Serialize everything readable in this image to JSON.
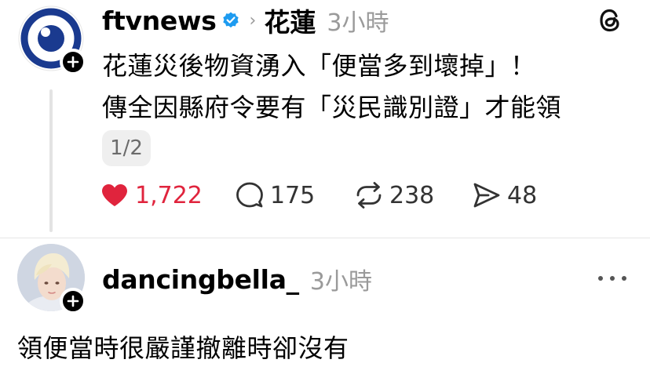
{
  "post": {
    "username": "ftvnews",
    "topic": "花蓮",
    "time": "3小時",
    "lines": [
      "花蓮災後物資湧入「便當多到壞掉」！",
      "傳全因縣府令要有「災民識別證」才能領"
    ],
    "media_page": "1/2",
    "likes": "1,722",
    "comments": "175",
    "reposts": "238",
    "shares": "48"
  },
  "reply": {
    "username": "dancingbella_",
    "time": "3小時",
    "text": "領便當時很嚴謹撤離時卻沒有"
  },
  "icons": {
    "verified": "verified-badge-icon",
    "threads": "threads-logo-icon",
    "like": "heart-icon",
    "comment": "comment-icon",
    "repost": "repost-icon",
    "share": "share-icon",
    "more": "more-options-icon"
  },
  "colors": {
    "like_active": "#e0243d",
    "verified": "#1d9bf0",
    "brand_blue": "#1a3a8f",
    "muted": "#9a9a9a"
  }
}
